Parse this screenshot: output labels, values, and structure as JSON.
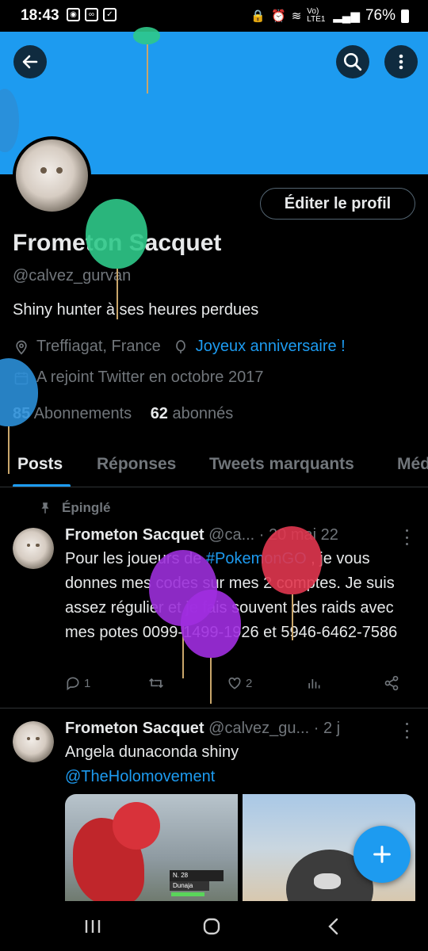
{
  "status_bar": {
    "time": "18:43",
    "network_label": "Vo) LTE1",
    "battery": "76%"
  },
  "header": {
    "back_icon": "arrow-left-icon",
    "search_icon": "search-icon",
    "more_icon": "more-vertical-icon"
  },
  "profile": {
    "edit_label": "Éditer le profil",
    "display_name": "Frometon Sacquet",
    "handle": "@calvez_gurvan",
    "bio": "Shiny hunter à ses heures perdues",
    "location": "Treffiagat, France",
    "birthday": "Joyeux anniversaire !",
    "joined": "A rejoint Twitter en octobre 2017",
    "following_count": "85",
    "following_label": "Abonnements",
    "followers_count": "62",
    "followers_label": "abonnés"
  },
  "tabs": [
    {
      "label": "Posts"
    },
    {
      "label": "Réponses"
    },
    {
      "label": "Tweets marquants"
    },
    {
      "label": "Méd"
    }
  ],
  "tweets": [
    {
      "pinned_label": "Épinglé",
      "name": "Frometon Sacquet",
      "meta": "@ca... · 20 mai 22",
      "text_before": "Pour les joueurs de ",
      "hashtag": "#PokemonGO",
      "text_after": " , je vous donnes mes codes sur mes 2 comptes. Je suis assez régulier et je fais souvent des raids avec mes potes 0099-1499-1926 et 5946-6462-7586",
      "replies": "1",
      "likes": "2"
    },
    {
      "name": "Frometon Sacquet",
      "meta": "@calvez_gu... · 2 j",
      "text": "Angela dunaconda shiny",
      "mention": "@TheHolomovement",
      "media_label_level": "N. 28",
      "media_label_name": "Dunaja"
    }
  ],
  "colors": {
    "accent": "#1d9bf0",
    "background": "#000000",
    "text": "#e7e9ea",
    "muted": "#71767b"
  }
}
